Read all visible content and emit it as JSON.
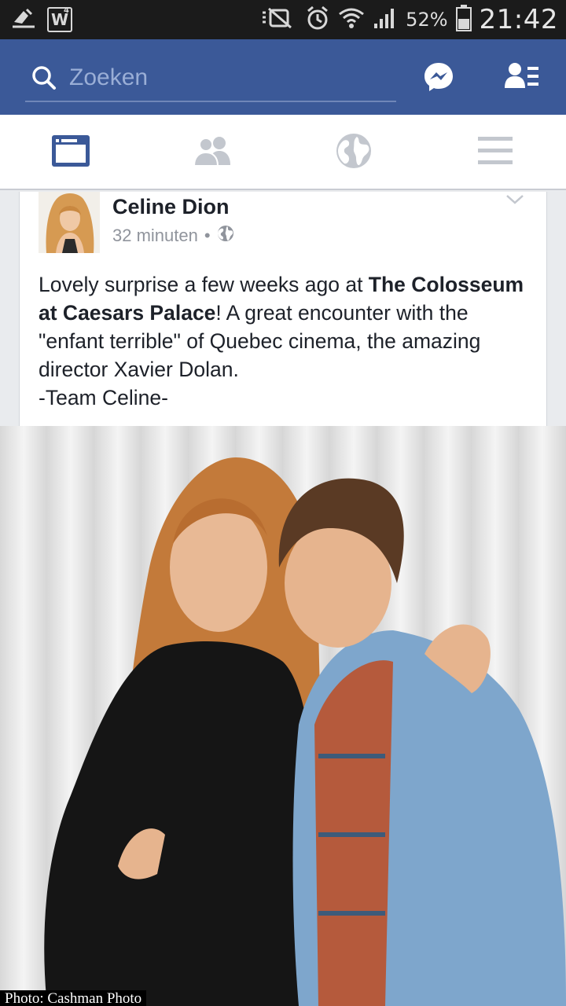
{
  "status_bar": {
    "battery_percent": "52%",
    "time": "21:42",
    "icons": [
      "download-icon",
      "w-app-icon",
      "mute-icon",
      "alarm-icon",
      "wifi-icon",
      "signal-icon",
      "battery-icon"
    ]
  },
  "header": {
    "search_placeholder": "Zoeken",
    "icons": [
      "search-icon",
      "messenger-icon",
      "friend-requests-icon"
    ],
    "brand_color": "#3b5998"
  },
  "tabs": [
    {
      "icon": "news-feed-icon",
      "active": true
    },
    {
      "icon": "friends-icon",
      "active": false
    },
    {
      "icon": "globe-icon",
      "active": false
    },
    {
      "icon": "menu-icon",
      "active": false
    }
  ],
  "post": {
    "author": "Celine Dion",
    "time": "32 minuten",
    "dot": "•",
    "privacy_icon": "globe-icon",
    "text_1": "Lovely surprise a few weeks ago at ",
    "text_bold": "The Colosseum at Caesars Palace",
    "text_2": "! A great encounter with the \"enfant terrible\" of Quebec cinema, the amazing director Xavier Dolan.",
    "text_3": "-Team Celine-",
    "photo_credit": "Photo: Cashman Photo"
  }
}
